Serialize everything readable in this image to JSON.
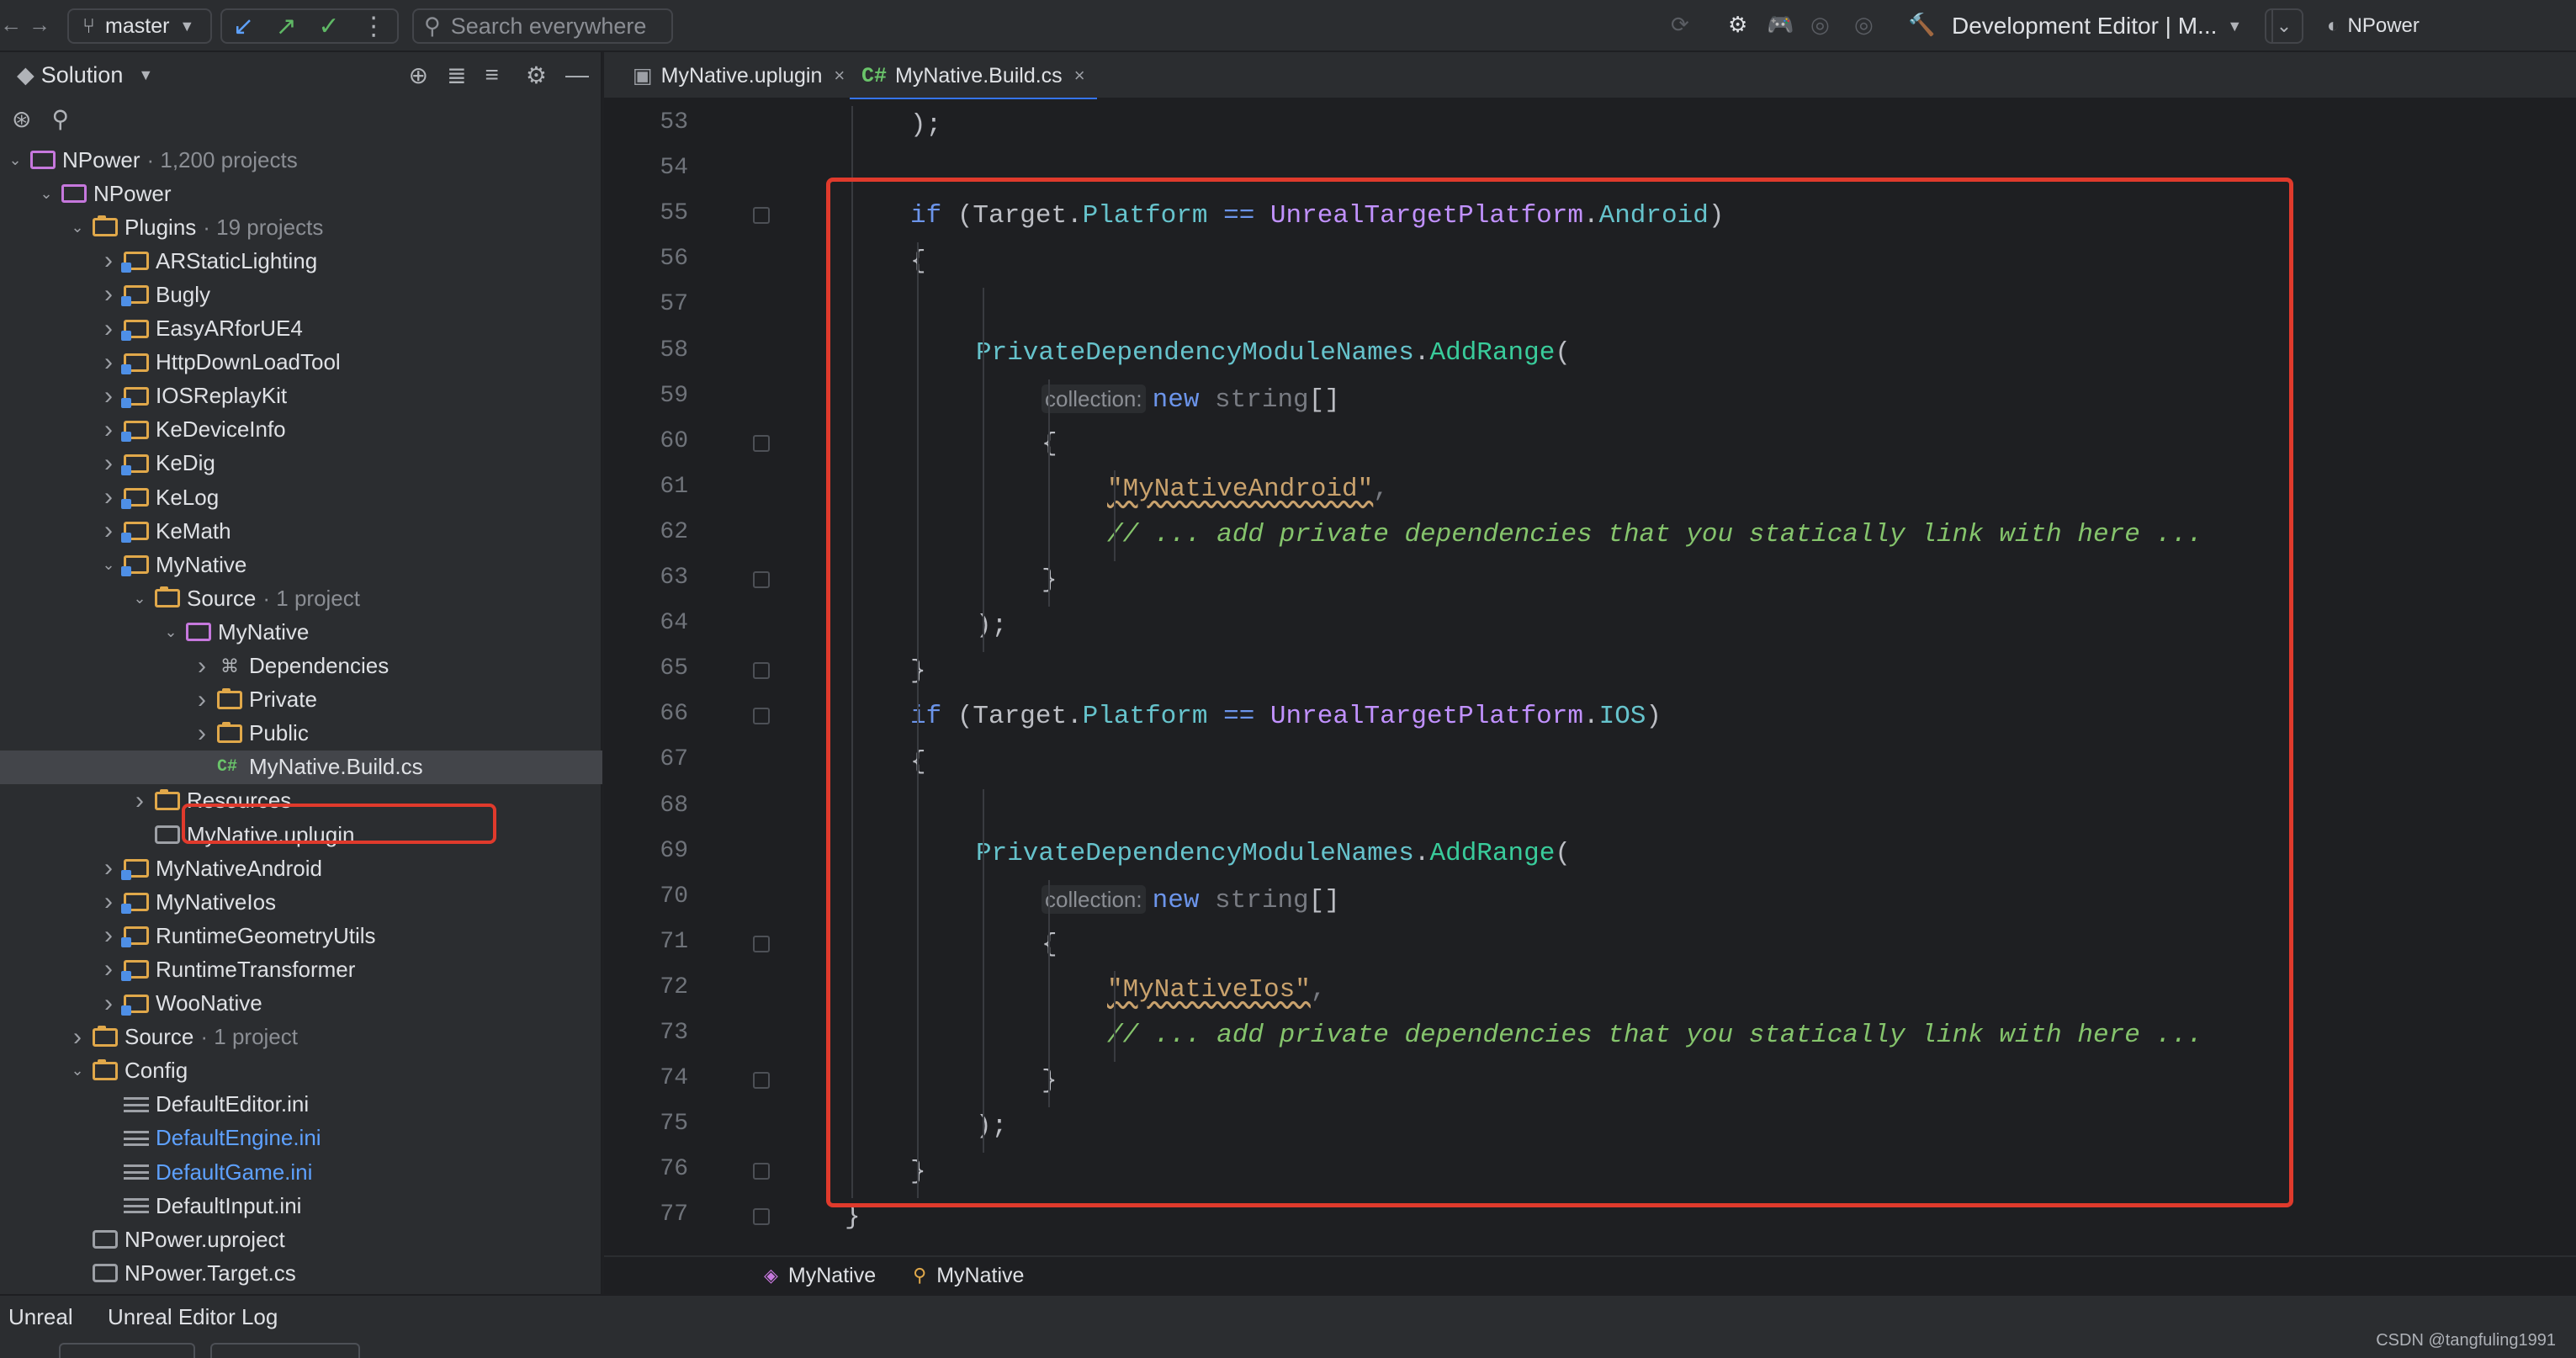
{
  "toolbar": {
    "branch": "master",
    "search_placeholder": "Search everywhere",
    "run_config": "Development Editor | M...",
    "project": "NPower"
  },
  "sidebar": {
    "title": "Solution",
    "tree": [
      {
        "label": "NPower",
        "sub": "· 1,200 projects",
        "depth": 0,
        "arrow": "v",
        "icon": "proj"
      },
      {
        "label": "NPower",
        "sub": "",
        "depth": 1,
        "arrow": "v",
        "icon": "proj"
      },
      {
        "label": "Plugins",
        "sub": "· 19 projects",
        "depth": 2,
        "arrow": "v",
        "icon": "folder"
      },
      {
        "label": "ARStaticLighting",
        "sub": "",
        "depth": 3,
        "arrow": ">",
        "icon": "plugin"
      },
      {
        "label": "Bugly",
        "sub": "",
        "depth": 3,
        "arrow": ">",
        "icon": "plugin"
      },
      {
        "label": "EasyARforUE4",
        "sub": "",
        "depth": 3,
        "arrow": ">",
        "icon": "plugin"
      },
      {
        "label": "HttpDownLoadTool",
        "sub": "",
        "depth": 3,
        "arrow": ">",
        "icon": "plugin"
      },
      {
        "label": "IOSReplayKit",
        "sub": "",
        "depth": 3,
        "arrow": ">",
        "icon": "plugin"
      },
      {
        "label": "KeDeviceInfo",
        "sub": "",
        "depth": 3,
        "arrow": ">",
        "icon": "plugin"
      },
      {
        "label": "KeDig",
        "sub": "",
        "depth": 3,
        "arrow": ">",
        "icon": "plugin"
      },
      {
        "label": "KeLog",
        "sub": "",
        "depth": 3,
        "arrow": ">",
        "icon": "plugin"
      },
      {
        "label": "KeMath",
        "sub": "",
        "depth": 3,
        "arrow": ">",
        "icon": "plugin"
      },
      {
        "label": "MyNative",
        "sub": "",
        "depth": 3,
        "arrow": "v",
        "icon": "plugin"
      },
      {
        "label": "Source",
        "sub": "· 1 project",
        "depth": 4,
        "arrow": "v",
        "icon": "folder"
      },
      {
        "label": "MyNative",
        "sub": "",
        "depth": 5,
        "arrow": "v",
        "icon": "proj"
      },
      {
        "label": "Dependencies",
        "sub": "",
        "depth": 6,
        "arrow": ">",
        "icon": "dep"
      },
      {
        "label": "Private",
        "sub": "",
        "depth": 6,
        "arrow": ">",
        "icon": "folder"
      },
      {
        "label": "Public",
        "sub": "",
        "depth": 6,
        "arrow": ">",
        "icon": "folder"
      },
      {
        "label": "MyNative.Build.cs",
        "sub": "",
        "depth": 6,
        "arrow": "",
        "icon": "cs",
        "selected": true
      },
      {
        "label": "Resources",
        "sub": "",
        "depth": 4,
        "arrow": ">",
        "icon": "folder"
      },
      {
        "label": "MyNative.uplugin",
        "sub": "",
        "depth": 4,
        "arrow": "",
        "icon": "up"
      },
      {
        "label": "MyNativeAndroid",
        "sub": "",
        "depth": 3,
        "arrow": ">",
        "icon": "plugin"
      },
      {
        "label": "MyNativeIos",
        "sub": "",
        "depth": 3,
        "arrow": ">",
        "icon": "plugin"
      },
      {
        "label": "RuntimeGeometryUtils",
        "sub": "",
        "depth": 3,
        "arrow": ">",
        "icon": "plugin"
      },
      {
        "label": "RuntimeTransformer",
        "sub": "",
        "depth": 3,
        "arrow": ">",
        "icon": "plugin"
      },
      {
        "label": "WooNative",
        "sub": "",
        "depth": 3,
        "arrow": ">",
        "icon": "plugin"
      },
      {
        "label": "Source",
        "sub": "· 1 project",
        "depth": 2,
        "arrow": ">",
        "icon": "folder"
      },
      {
        "label": "Config",
        "sub": "",
        "depth": 2,
        "arrow": "v",
        "icon": "folder"
      },
      {
        "label": "DefaultEditor.ini",
        "sub": "",
        "depth": 3,
        "arrow": "",
        "icon": "ini"
      },
      {
        "label": "DefaultEngine.ini",
        "sub": "",
        "depth": 3,
        "arrow": "",
        "icon": "ini",
        "blue": true
      },
      {
        "label": "DefaultGame.ini",
        "sub": "",
        "depth": 3,
        "arrow": "",
        "icon": "ini",
        "blue": true
      },
      {
        "label": "DefaultInput.ini",
        "sub": "",
        "depth": 3,
        "arrow": "",
        "icon": "ini"
      },
      {
        "label": "NPower.uproject",
        "sub": "",
        "depth": 2,
        "arrow": "",
        "icon": "up"
      },
      {
        "label": "NPower.Target.cs",
        "sub": "",
        "depth": 2,
        "arrow": "",
        "icon": "up"
      }
    ]
  },
  "tabs": [
    {
      "label": "MyNative.uplugin",
      "prefix": "",
      "active": false
    },
    {
      "label": "MyNative.Build.cs",
      "prefix": "C#",
      "active": true
    }
  ],
  "editor": {
    "lines": [
      {
        "num": "53",
        "indent": 2,
        "tokens": [
          [
            "",
            ");"
          ]
        ]
      },
      {
        "num": "54",
        "indent": 0,
        "tokens": []
      },
      {
        "num": "55",
        "indent": 2,
        "tokens": [
          [
            "kw",
            "if"
          ],
          [
            "",
            " (Target."
          ],
          [
            "fld",
            "Platform"
          ],
          [
            "",
            " "
          ],
          [
            "kw",
            "=="
          ],
          [
            "",
            " "
          ],
          [
            "ty",
            "UnrealTargetPlatform"
          ],
          [
            "",
            "."
          ],
          [
            "fld",
            "Android"
          ],
          [
            "",
            ")"
          ]
        ]
      },
      {
        "num": "56",
        "indent": 2,
        "tokens": [
          [
            "",
            "{"
          ]
        ]
      },
      {
        "num": "57",
        "indent": 0,
        "tokens": []
      },
      {
        "num": "58",
        "indent": 3,
        "tokens": [
          [
            "fld",
            "PrivateDependencyModuleNames"
          ],
          [
            "",
            "."
          ],
          [
            "mth",
            "AddRange"
          ],
          [
            "",
            "("
          ]
        ]
      },
      {
        "num": "59",
        "indent": 4,
        "tokens": [
          [
            "hint",
            "collection:"
          ],
          [
            "kw",
            "new"
          ],
          [
            "",
            " "
          ],
          [
            "gray",
            "string"
          ],
          [
            "",
            "[]"
          ]
        ]
      },
      {
        "num": "60",
        "indent": 4,
        "tokens": [
          [
            "",
            "{"
          ]
        ]
      },
      {
        "num": "61",
        "indent": 5,
        "tokens": [
          [
            "str",
            "\"MyNativeAndroid\""
          ],
          [
            "gray",
            ","
          ]
        ]
      },
      {
        "num": "62",
        "indent": 5,
        "tokens": [
          [
            "cmt",
            "// ... add private dependencies that you statically link with here ..."
          ]
        ]
      },
      {
        "num": "63",
        "indent": 4,
        "tokens": [
          [
            "",
            "}"
          ]
        ]
      },
      {
        "num": "64",
        "indent": 3,
        "tokens": [
          [
            "",
            ");"
          ]
        ]
      },
      {
        "num": "65",
        "indent": 2,
        "tokens": [
          [
            "",
            "}"
          ]
        ]
      },
      {
        "num": "66",
        "indent": 2,
        "tokens": [
          [
            "kw",
            "if"
          ],
          [
            "",
            " (Target."
          ],
          [
            "fld",
            "Platform"
          ],
          [
            "",
            " "
          ],
          [
            "kw",
            "=="
          ],
          [
            "",
            " "
          ],
          [
            "ty",
            "UnrealTargetPlatform"
          ],
          [
            "",
            "."
          ],
          [
            "fld",
            "IOS"
          ],
          [
            "",
            ")"
          ]
        ]
      },
      {
        "num": "67",
        "indent": 2,
        "tokens": [
          [
            "",
            "{"
          ]
        ]
      },
      {
        "num": "68",
        "indent": 0,
        "tokens": []
      },
      {
        "num": "69",
        "indent": 3,
        "tokens": [
          [
            "fld",
            "PrivateDependencyModuleNames"
          ],
          [
            "",
            "."
          ],
          [
            "mth",
            "AddRange"
          ],
          [
            "",
            "("
          ]
        ]
      },
      {
        "num": "70",
        "indent": 4,
        "tokens": [
          [
            "hint",
            "collection:"
          ],
          [
            "kw",
            "new"
          ],
          [
            "",
            " "
          ],
          [
            "gray",
            "string"
          ],
          [
            "",
            "[]"
          ]
        ]
      },
      {
        "num": "71",
        "indent": 4,
        "tokens": [
          [
            "",
            "{"
          ]
        ]
      },
      {
        "num": "72",
        "indent": 5,
        "tokens": [
          [
            "str",
            "\"MyNativeIos\""
          ],
          [
            "gray",
            ","
          ]
        ]
      },
      {
        "num": "73",
        "indent": 5,
        "tokens": [
          [
            "cmt",
            "// ... add private dependencies that you statically link with here ..."
          ]
        ]
      },
      {
        "num": "74",
        "indent": 4,
        "tokens": [
          [
            "",
            "}"
          ]
        ]
      },
      {
        "num": "75",
        "indent": 3,
        "tokens": [
          [
            "",
            ");"
          ]
        ]
      },
      {
        "num": "76",
        "indent": 2,
        "tokens": [
          [
            "",
            "}"
          ]
        ]
      },
      {
        "num": "77",
        "indent": 1,
        "tokens": [
          [
            "",
            "}"
          ]
        ]
      }
    ]
  },
  "breadcrumbs": [
    "MyNative",
    "MyNative"
  ],
  "bottom": {
    "tabs": [
      "Unreal",
      "Unreal Editor Log"
    ],
    "watermark": "CSDN @tangfuling1991"
  }
}
